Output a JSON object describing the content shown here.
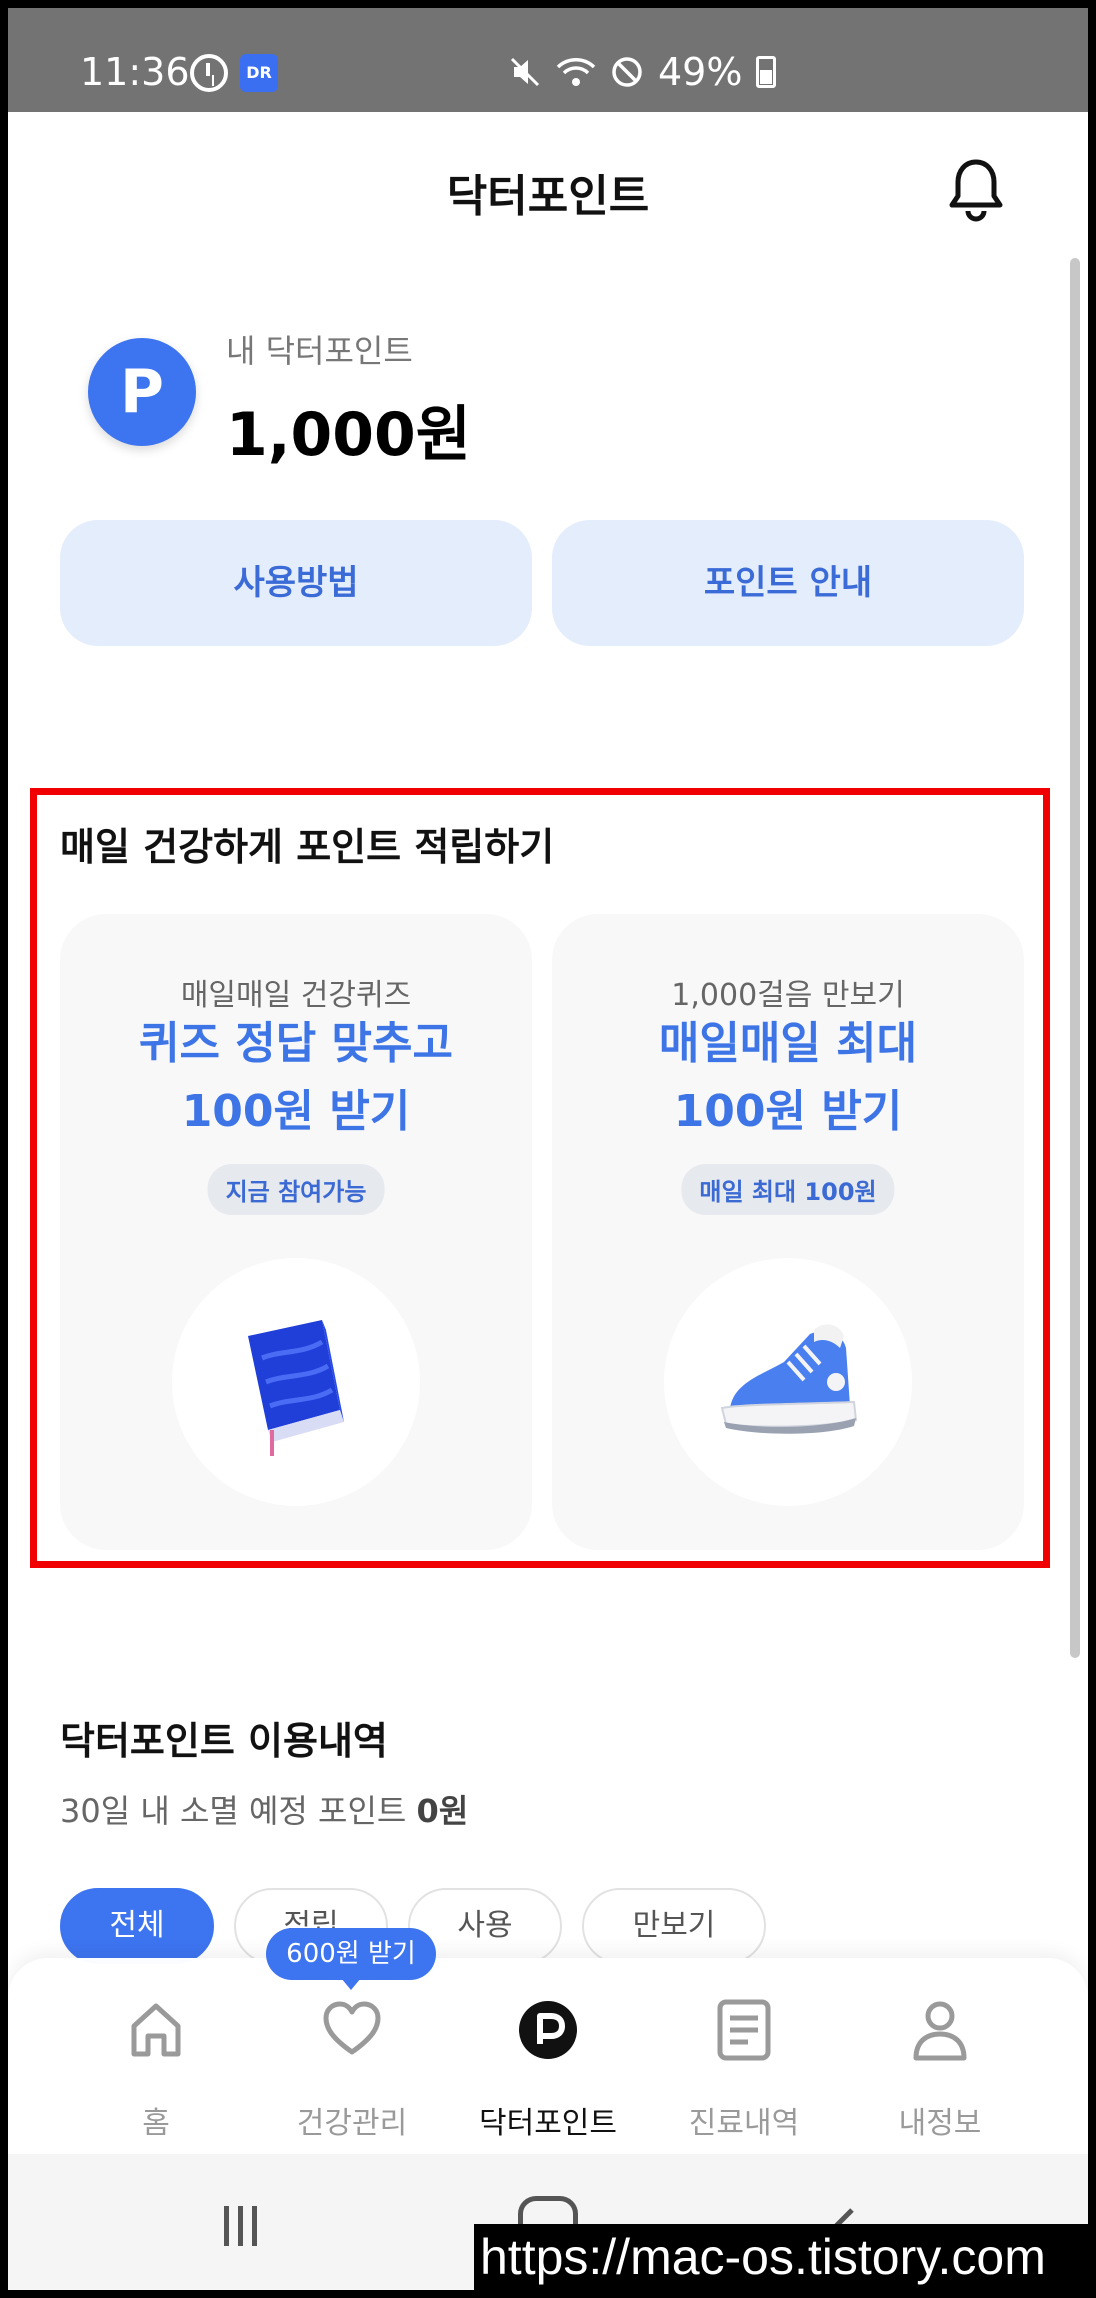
{
  "status_bar": {
    "time": "11:36",
    "app_badge": "DR",
    "battery": "49%"
  },
  "header": {
    "title": "닥터포인트"
  },
  "points": {
    "avatar_letter": "P",
    "label": "내 닥터포인트",
    "amount": "1,000원"
  },
  "actions": {
    "how_to_use": "사용방법",
    "point_guide": "포인트 안내"
  },
  "daily": {
    "title": "매일 건강하게 포인트 적립하기",
    "cards": [
      {
        "subtitle": "매일매일 건강퀴즈",
        "line1": "퀴즈 정답 맞추고",
        "line2": "100원 받기",
        "badge": "지금 참여가능",
        "icon": "book-icon"
      },
      {
        "subtitle": "1,000걸음 만보기",
        "line1": "매일매일 최대",
        "line2": "100원 받기",
        "badge": "매일 최대 100원",
        "icon": "sneaker-icon"
      }
    ]
  },
  "history": {
    "title": "닥터포인트 이용내역",
    "expiry_text": "30일 내 소멸 예정 포인트 ",
    "expiry_value": "0원",
    "filters": [
      "전체",
      "적립",
      "사용",
      "만보기"
    ]
  },
  "tooltip": "600원 받기",
  "bottom_nav": {
    "items": [
      {
        "label": "홈",
        "icon": "home-icon"
      },
      {
        "label": "건강관리",
        "icon": "heart-icon"
      },
      {
        "label": "닥터포인트",
        "icon": "point-icon",
        "active": true
      },
      {
        "label": "진료내역",
        "icon": "document-icon"
      },
      {
        "label": "내정보",
        "icon": "user-icon"
      }
    ]
  },
  "watermark": "https://mac-os.tistory.com",
  "colors": {
    "accent": "#3d74f0",
    "highlight": "#f00000",
    "pill_bg": "#e4edfc"
  }
}
